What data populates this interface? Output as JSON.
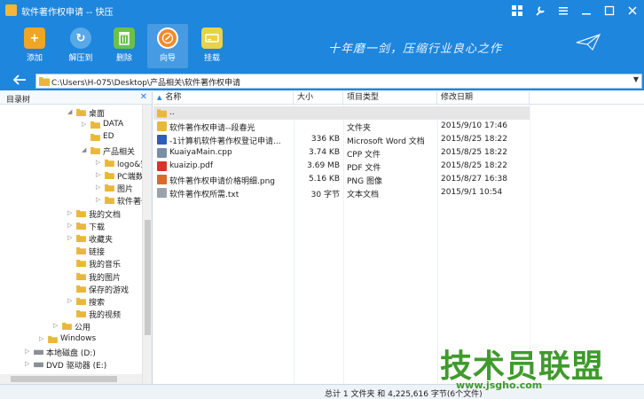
{
  "window": {
    "title": "软件著作权申请 -- 快压"
  },
  "toolbar": {
    "buttons": [
      {
        "label": "添加",
        "icon": "add-icon",
        "color": "#f0a526"
      },
      {
        "label": "解压到",
        "icon": "extract-icon",
        "color": "#58a9e8"
      },
      {
        "label": "删除",
        "icon": "delete-icon",
        "color": "#6cc04a"
      },
      {
        "label": "向导",
        "icon": "wizard-icon",
        "color": "#f28a2d"
      },
      {
        "label": "挂载",
        "icon": "mount-icon",
        "color": "#e8d24a"
      }
    ],
    "slogan": "十年磨一剑，压缩行业良心之作"
  },
  "address": {
    "path": "C:\\Users\\H-075\\Desktop\\产品相关\\软件著作权申请"
  },
  "tree": {
    "header": "目录树",
    "items": [
      {
        "label": "桌面",
        "indent": 2
      },
      {
        "label": "DATA",
        "indent": 3
      },
      {
        "label": "ED",
        "indent": 3
      },
      {
        "label": "产品相关",
        "indent": 3
      },
      {
        "label": "logo&安卓",
        "indent": 4
      },
      {
        "label": "PC端数据",
        "indent": 4
      },
      {
        "label": "图片",
        "indent": 4
      },
      {
        "label": "软件著作权",
        "indent": 4
      },
      {
        "label": "我的文档",
        "indent": 2
      },
      {
        "label": "下载",
        "indent": 2
      },
      {
        "label": "收藏夹",
        "indent": 2
      },
      {
        "label": "链接",
        "indent": 2
      },
      {
        "label": "我的音乐",
        "indent": 2
      },
      {
        "label": "我的图片",
        "indent": 2
      },
      {
        "label": "保存的游戏",
        "indent": 2
      },
      {
        "label": "搜索",
        "indent": 2
      },
      {
        "label": "我的视频",
        "indent": 2
      },
      {
        "label": "公用",
        "indent": 1
      },
      {
        "label": "Windows",
        "indent": 0
      },
      {
        "label": "本地磁盘 (D:)",
        "indent": -1
      },
      {
        "label": "DVD 驱动器 (E:)",
        "indent": -1
      }
    ]
  },
  "list": {
    "columns": [
      "名称",
      "大小",
      "项目类型",
      "修改日期"
    ],
    "parent_label": "..",
    "rows": [
      {
        "name": "软件著作权申请--段春光",
        "size": "",
        "type": "文件夹",
        "date": "2015/9/10 17:46",
        "icon": "folder"
      },
      {
        "name": "-1计算机软件著作权登记申请...",
        "size": "336 KB",
        "type": "Microsoft Word 文档",
        "date": "2015/8/25 18:22",
        "icon": "word"
      },
      {
        "name": "KuaiyaMain.cpp",
        "size": "3.74 KB",
        "type": "CPP 文件",
        "date": "2015/8/25 18:22",
        "icon": "cpp"
      },
      {
        "name": "kuaizip.pdf",
        "size": "3.69 MB",
        "type": "PDF 文件",
        "date": "2015/8/25 18:22",
        "icon": "pdf"
      },
      {
        "name": "软件著作权申请价格明细.png",
        "size": "5.16 KB",
        "type": "PNG 图像",
        "date": "2015/8/27 16:38",
        "icon": "png"
      },
      {
        "name": "软件著作权所需.txt",
        "size": "30 字节",
        "type": "文本文档",
        "date": "2015/9/1 10:54",
        "icon": "txt"
      }
    ]
  },
  "status": {
    "text": "总计 1 文件夹 和 4,225,616 字节(6个文件)"
  },
  "watermark": {
    "title": "技术员联盟",
    "url": "www.jsgho.com"
  }
}
